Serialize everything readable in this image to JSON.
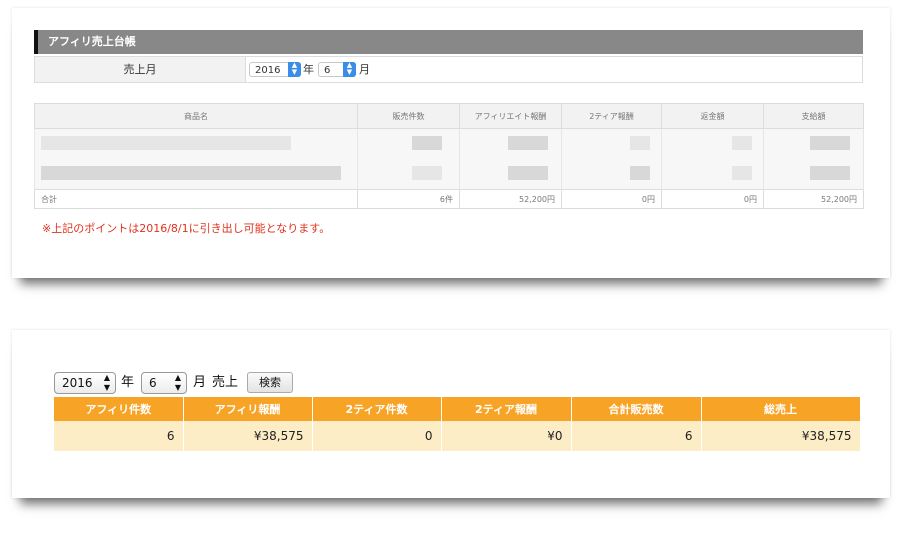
{
  "ledger_panel": {
    "title": "アフィリ売上台帳",
    "month_label": "売上月",
    "year_value": "2016",
    "year_unit": "年",
    "month_value": "6",
    "month_unit": "月",
    "columns": [
      "商品名",
      "販売件数",
      "アフィリエイト報酬",
      "2ティア報酬",
      "返金額",
      "支給額"
    ],
    "total_row": {
      "label": "合計",
      "count": "6件",
      "affiliate": "52,200円",
      "tier2": "0円",
      "refund": "0円",
      "payout": "52,200円"
    },
    "note": "※上記のポイントは2016/8/1に引き出し可能となります。"
  },
  "summary_panel": {
    "year_value": "2016",
    "year_unit": "年",
    "month_value": "6",
    "month_unit": "月",
    "sales_label": "売上",
    "search_button": "検索",
    "columns": [
      "アフィリ件数",
      "アフィリ報酬",
      "2ティア件数",
      "2ティア報酬",
      "合計販売数",
      "総売上"
    ],
    "row": [
      "6",
      "¥38,575",
      "0",
      "¥0",
      "6",
      "¥38,575"
    ]
  },
  "colors": {
    "header_orange": "#f7a426",
    "row_cream": "#fdedc7",
    "note_red": "#e0321e",
    "panel_gray": "#888888"
  }
}
